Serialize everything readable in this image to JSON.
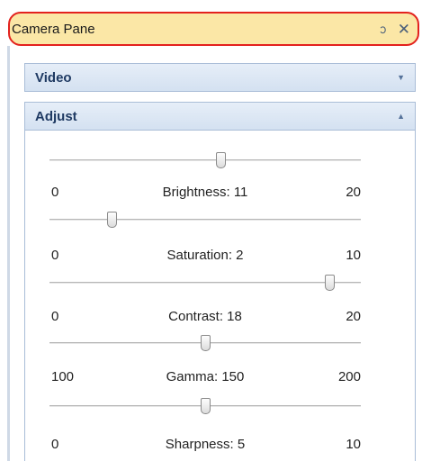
{
  "pane": {
    "title": "Camera Pane"
  },
  "groups": [
    {
      "label": "Video",
      "expanded": false
    },
    {
      "label": "Adjust",
      "expanded": true
    }
  ],
  "sliders": [
    {
      "name": "Brightness",
      "label": "Brightness: 11",
      "min_label": "0",
      "max_label": "20",
      "min": 0,
      "max": 20,
      "value": 11
    },
    {
      "name": "Saturation",
      "label": "Saturation: 2",
      "min_label": "0",
      "max_label": "10",
      "min": 0,
      "max": 10,
      "value": 2
    },
    {
      "name": "Contrast",
      "label": "Contrast: 18",
      "min_label": "0",
      "max_label": "20",
      "min": 0,
      "max": 20,
      "value": 18
    },
    {
      "name": "Gamma",
      "label": "Gamma: 150",
      "min_label": "100",
      "max_label": "200",
      "min": 100,
      "max": 200,
      "value": 150
    },
    {
      "name": "Sharpness",
      "label": "Sharpness: 5",
      "min_label": "0",
      "max_label": "10",
      "min": 0,
      "max": 10,
      "value": 5
    }
  ],
  "colors": {
    "header_bg": "#fbe7a6",
    "header_outline": "#e3221e",
    "group_header_bg": "#d4e1f1",
    "group_label": "#1f3a63"
  }
}
